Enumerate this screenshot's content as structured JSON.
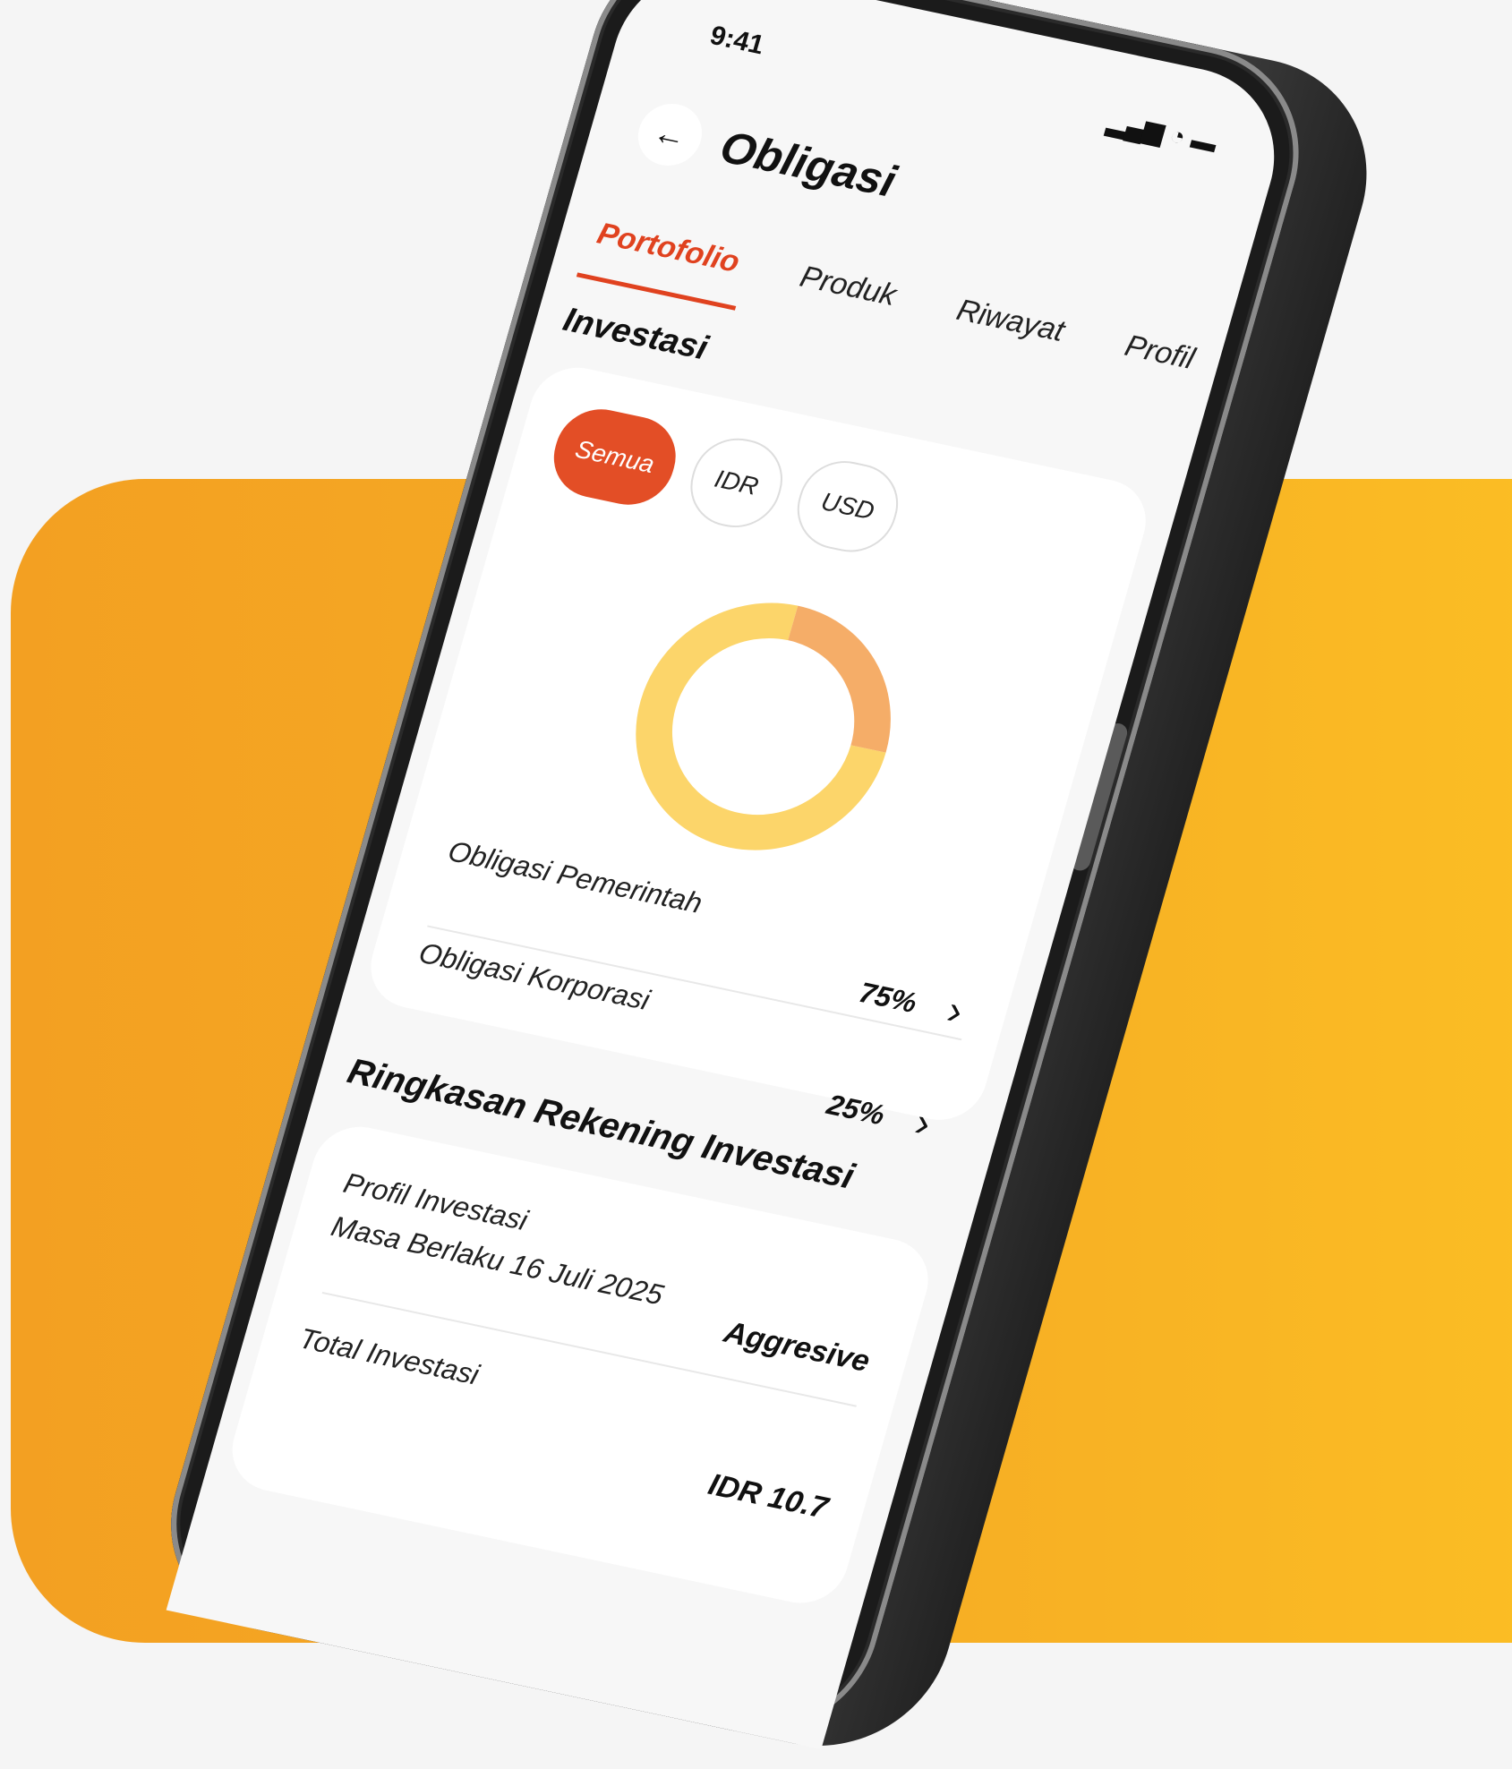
{
  "status_bar": {
    "time": "9:41",
    "icons": [
      "signal-icon",
      "wifi-icon",
      "battery-icon"
    ]
  },
  "header": {
    "back_icon": "arrow-left-icon",
    "title": "Obligasi"
  },
  "tabs": [
    {
      "label": "Portofolio",
      "active": true
    },
    {
      "label": "Produk",
      "active": false
    },
    {
      "label": "Riwayat",
      "active": false
    },
    {
      "label": "Profil",
      "active": false
    }
  ],
  "investasi": {
    "title": "Investasi",
    "filters": [
      {
        "label": "Semua",
        "active": true
      },
      {
        "label": "IDR",
        "active": false
      },
      {
        "label": "USD",
        "active": false
      }
    ],
    "allocations": [
      {
        "label": "Obligasi Pemerintah",
        "value": "75%"
      },
      {
        "label": "Obligasi Korporasi",
        "value": "25%"
      }
    ]
  },
  "chart_data": {
    "type": "pie",
    "categories": [
      "Obligasi Pemerintah",
      "Obligasi Korporasi"
    ],
    "values": [
      75,
      25
    ],
    "colors": [
      "#fcd56a",
      "#f5ad68"
    ],
    "title": "",
    "donut": true
  },
  "summary": {
    "title": "Ringkasan Rekening Investasi",
    "rows": [
      {
        "label": "Profil Investasi",
        "sublabel": "Masa Berlaku 16 Juli 2025",
        "value": "Aggresive"
      },
      {
        "label": "Total Investasi",
        "value": "IDR 10.7"
      }
    ]
  },
  "colors": {
    "accent": "#e34e26",
    "background_panel": "#f6ac24"
  }
}
